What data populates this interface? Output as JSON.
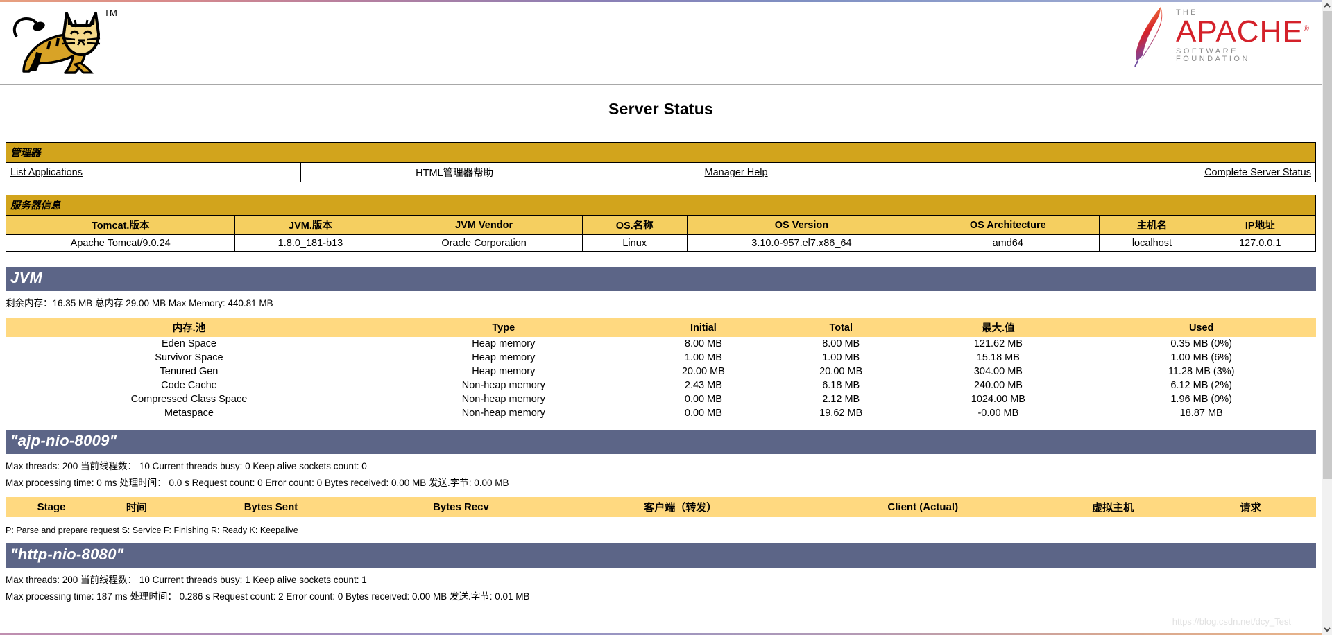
{
  "branding": {
    "tomcat_logo_alt": "Apache Tomcat",
    "tomcat_tm": "TM",
    "apache_the": "THE",
    "apache_name": "APACHE",
    "apache_reg": "®",
    "apache_sub": "SOFTWARE FOUNDATION"
  },
  "page_title": "Server Status",
  "manager": {
    "heading": "管理器",
    "links": [
      {
        "label": "List Applications",
        "align": "left"
      },
      {
        "label": "HTML管理器帮助",
        "align": "center"
      },
      {
        "label": "Manager Help",
        "align": "center"
      },
      {
        "label": "Complete Server Status",
        "align": "right"
      }
    ]
  },
  "server_info": {
    "heading": "服务器信息",
    "headers": [
      "Tomcat.版本",
      "JVM.版本",
      "JVM Vendor",
      "OS.名称",
      "OS Version",
      "OS Architecture",
      "主机名",
      "IP地址"
    ],
    "values": [
      "Apache Tomcat/9.0.24",
      "1.8.0_181-b13",
      "Oracle Corporation",
      "Linux",
      "3.10.0-957.el7.x86_64",
      "amd64",
      "localhost",
      "127.0.0.1"
    ]
  },
  "jvm": {
    "heading": "JVM",
    "summary": "剩余内存：16.35 MB 总内存 29.00 MB Max Memory: 440.81 MB",
    "table": {
      "headers": [
        "内存.池",
        "Type",
        "Initial",
        "Total",
        "最大.值",
        "Used"
      ],
      "rows": [
        [
          "Eden Space",
          "Heap memory",
          "8.00 MB",
          "8.00 MB",
          "121.62 MB",
          "0.35 MB (0%)"
        ],
        [
          "Survivor Space",
          "Heap memory",
          "1.00 MB",
          "1.00 MB",
          "15.18 MB",
          "1.00 MB (6%)"
        ],
        [
          "Tenured Gen",
          "Heap memory",
          "20.00 MB",
          "20.00 MB",
          "304.00 MB",
          "11.28 MB (3%)"
        ],
        [
          "Code Cache",
          "Non-heap memory",
          "2.43 MB",
          "6.18 MB",
          "240.00 MB",
          "6.12 MB (2%)"
        ],
        [
          "Compressed Class Space",
          "Non-heap memory",
          "0.00 MB",
          "2.12 MB",
          "1024.00 MB",
          "1.96 MB (0%)"
        ],
        [
          "Metaspace",
          "Non-heap memory",
          "0.00 MB",
          "19.62 MB",
          "-0.00 MB",
          "18.87 MB"
        ]
      ]
    }
  },
  "connectors": [
    {
      "name": "\"ajp-nio-8009\"",
      "line1": "Max threads: 200 当前线程数：  10 Current threads busy: 0 Keep alive sockets count: 0",
      "line2": "Max processing time: 0 ms 处理时间：  0.0 s Request count: 0 Error count: 0 Bytes received: 0.00 MB 发送.字节: 0.00 MB",
      "stage_headers": [
        "Stage",
        "时间",
        "Bytes Sent",
        "Bytes Recv",
        "客户端（转发）",
        "Client (Actual)",
        "虚拟主机",
        "请求"
      ],
      "legend": "P: Parse and prepare request S: Service F: Finishing R: Ready K: Keepalive"
    },
    {
      "name": "\"http-nio-8080\"",
      "line1": "Max threads: 200 当前线程数：  10 Current threads busy: 1 Keep alive sockets count: 1",
      "line2": "Max processing time: 187 ms 处理时间：  0.286 s Request count: 2 Error count: 0 Bytes received: 0.00 MB 发送.字节: 0.01 MB"
    }
  ],
  "watermark": "https://blog.csdn.net/dcy_Test",
  "colors": {
    "gold_bar": "#d2a41c",
    "table_header": "#f5cf60",
    "mem_header": "#ffd980",
    "slate": "#5c6587",
    "apache_red": "#d4212a"
  }
}
